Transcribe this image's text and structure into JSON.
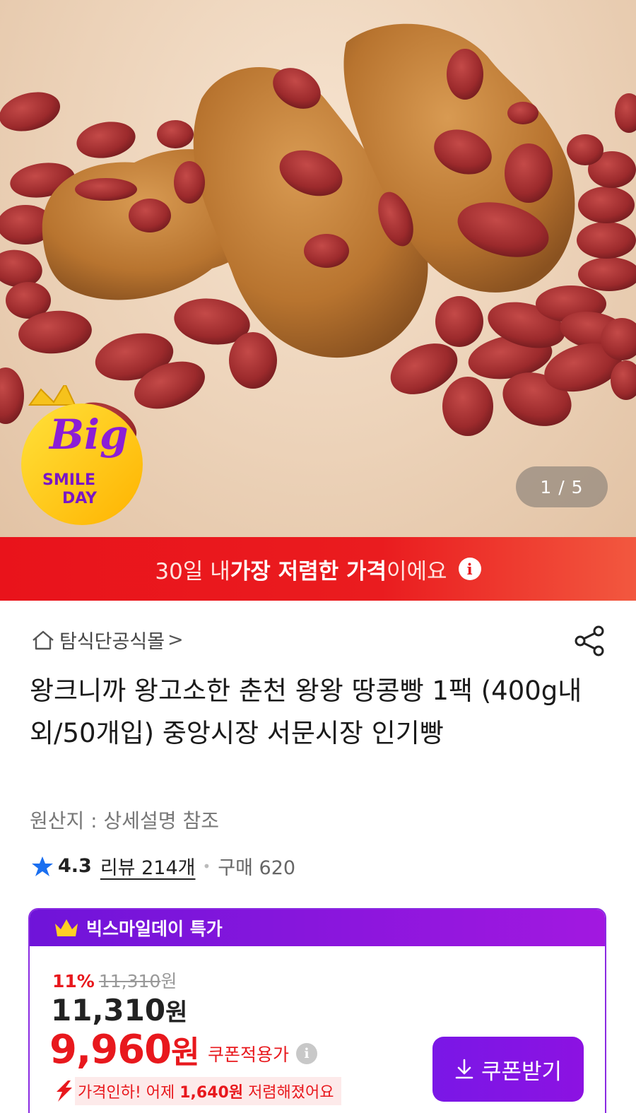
{
  "gallery": {
    "counter": "1 / 5",
    "badge": {
      "big": "Big",
      "line1": "SMILE",
      "line2": "DAY"
    }
  },
  "banner": {
    "prefix": "30일 내 ",
    "highlight": "가장 저렴한 가격",
    "suffix": "이에요",
    "icon": "info-icon"
  },
  "shop": {
    "name": "탐식단공식몰",
    "chevron": ">"
  },
  "product": {
    "title": "왕크니까 왕고소한 춘천 왕왕 땅콩빵 1팩 (400g내외/50개입) 중앙시장 서문시장 인기빵",
    "origin": "원산지 : 상세설명 참조",
    "rating": "4.3",
    "review": "리뷰 214개",
    "purchases": "구매 620"
  },
  "deal": {
    "header": "빅스마일데이 특가",
    "discount_percent": "11%",
    "original_price": "11,310",
    "original_unit": "원",
    "price": "11,310",
    "price_unit": "원",
    "coupon_price": "9,960",
    "coupon_unit": "원",
    "coupon_label": "쿠폰적용가",
    "drop_prefix": "가격인하! 어제 ",
    "drop_amount": "1,640원",
    "drop_suffix": " 저렴해졌어요",
    "coupon_button": "쿠폰받기"
  },
  "colors": {
    "accent_red": "#e8181d",
    "deal_purple": "#7a17e6"
  }
}
